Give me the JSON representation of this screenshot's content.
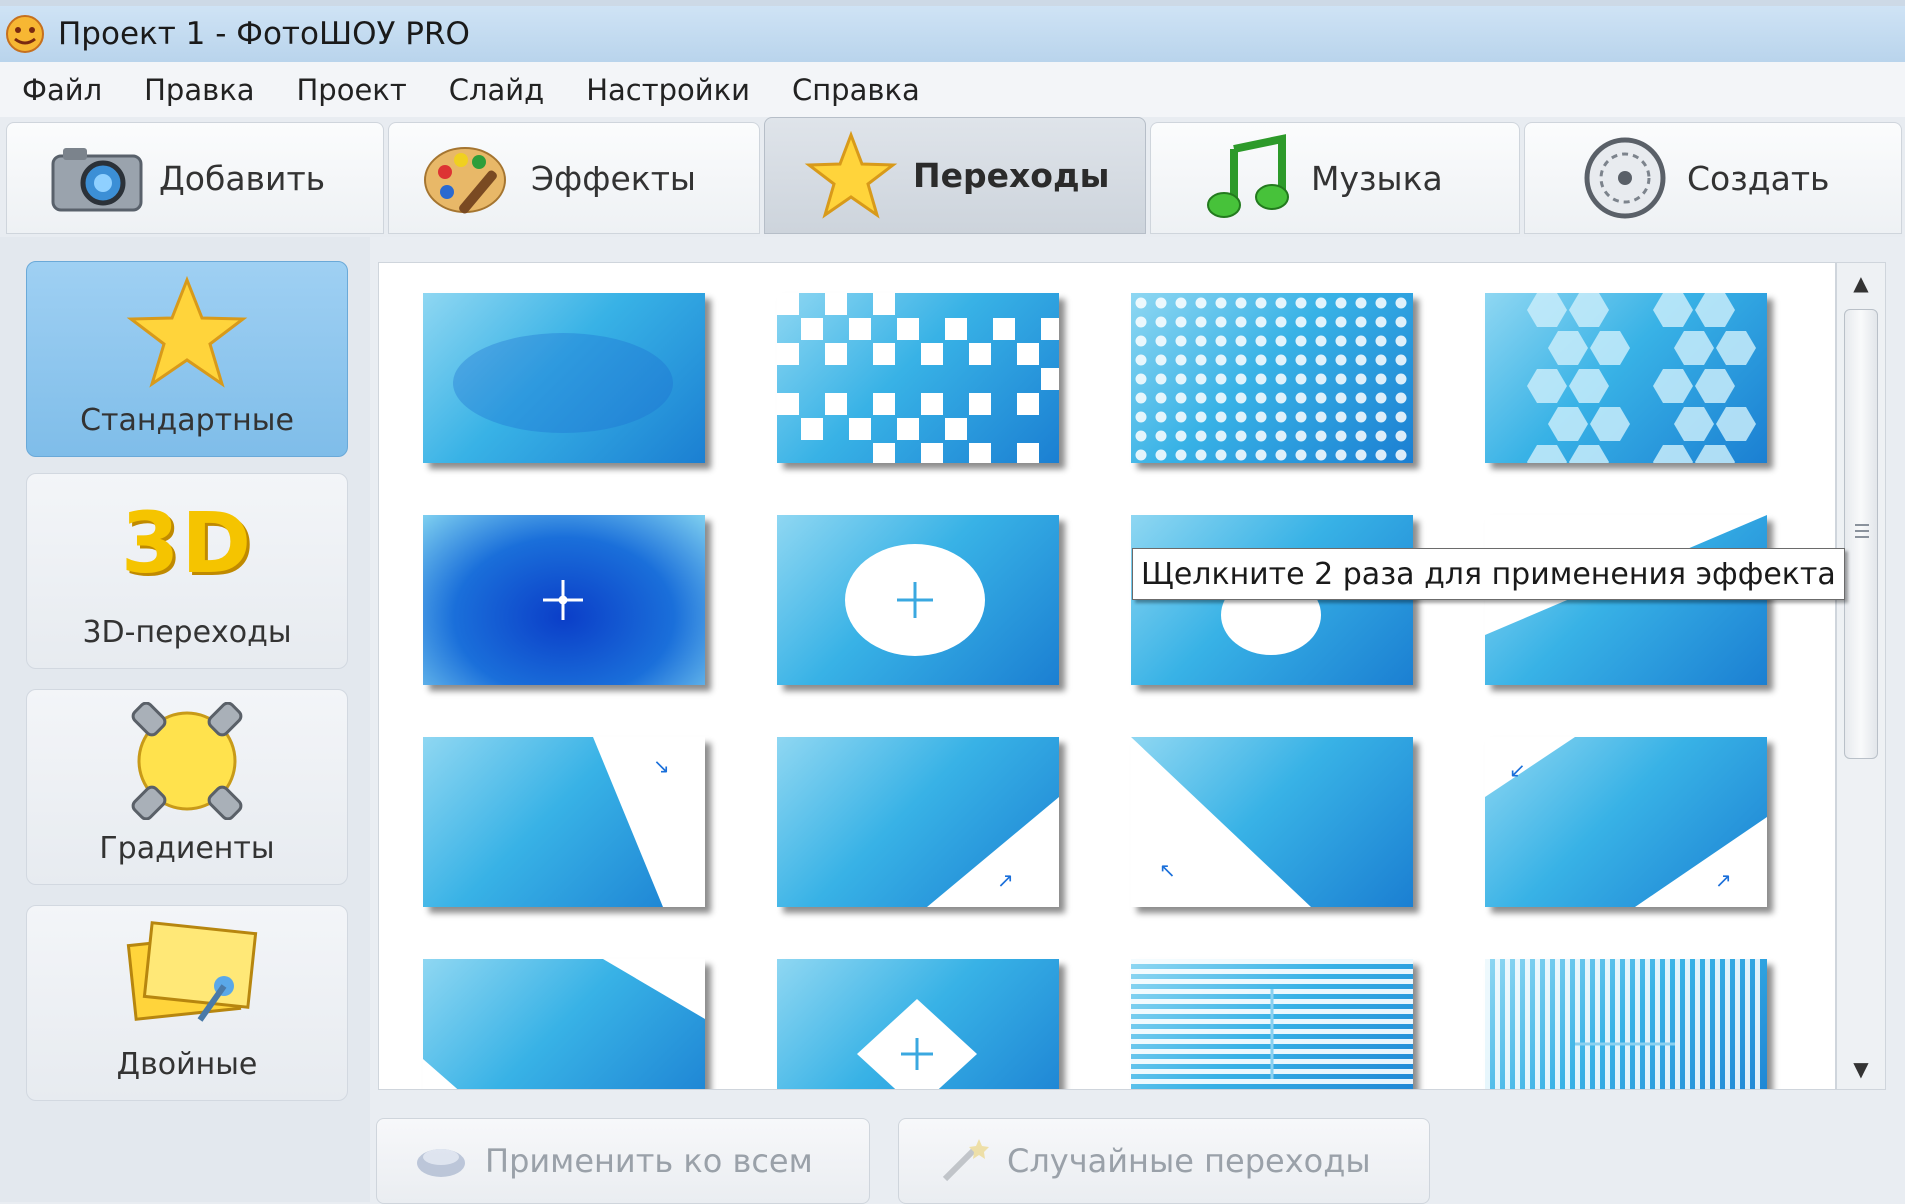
{
  "window": {
    "title": "Проект 1 - ФотоШОУ PRO"
  },
  "menu": [
    {
      "label": "Файл"
    },
    {
      "label": "Правка"
    },
    {
      "label": "Проект"
    },
    {
      "label": "Слайд"
    },
    {
      "label": "Настройки"
    },
    {
      "label": "Справка"
    }
  ],
  "toolbar": {
    "tabs": [
      {
        "label": "Добавить",
        "icon": "camera-icon",
        "active": false
      },
      {
        "label": "Эффекты",
        "icon": "palette-icon",
        "active": false
      },
      {
        "label": "Переходы",
        "icon": "star-icon",
        "active": true
      },
      {
        "label": "Музыка",
        "icon": "music-note-icon",
        "active": false
      },
      {
        "label": "Создать",
        "icon": "disc-icon",
        "active": false
      }
    ]
  },
  "categories": [
    {
      "label": "Стандартные",
      "icon": "star-icon",
      "active": true
    },
    {
      "label": "3D-переходы",
      "icon": "3d-icon",
      "icon_text": "3D",
      "active": false
    },
    {
      "label": "Градиенты",
      "icon": "gradient-circle-icon",
      "active": false
    },
    {
      "label": "Двойные",
      "icon": "double-notes-icon",
      "active": false
    }
  ],
  "transitions": {
    "count_visible": 16,
    "patterns": [
      "fade",
      "checker",
      "dots",
      "hexagons",
      "arrows-out",
      "circle",
      "circle-tooltip",
      "diagonal-top-right",
      "diagonal-tr",
      "diagonal-bl",
      "diagonal-tl",
      "diagonal-br",
      "diagonal-small",
      "diamond",
      "horizontal-stripes",
      "vertical-stripes"
    ]
  },
  "tooltip": {
    "text": "Щелкните 2 раза для применения эффекта"
  },
  "buttons": {
    "apply_all": "Применить ко всем",
    "random": "Случайные переходы"
  },
  "colors": {
    "accent": "#7fbde9",
    "thumb_light": "#8fd7f2",
    "thumb_dark": "#1b7fd2"
  }
}
